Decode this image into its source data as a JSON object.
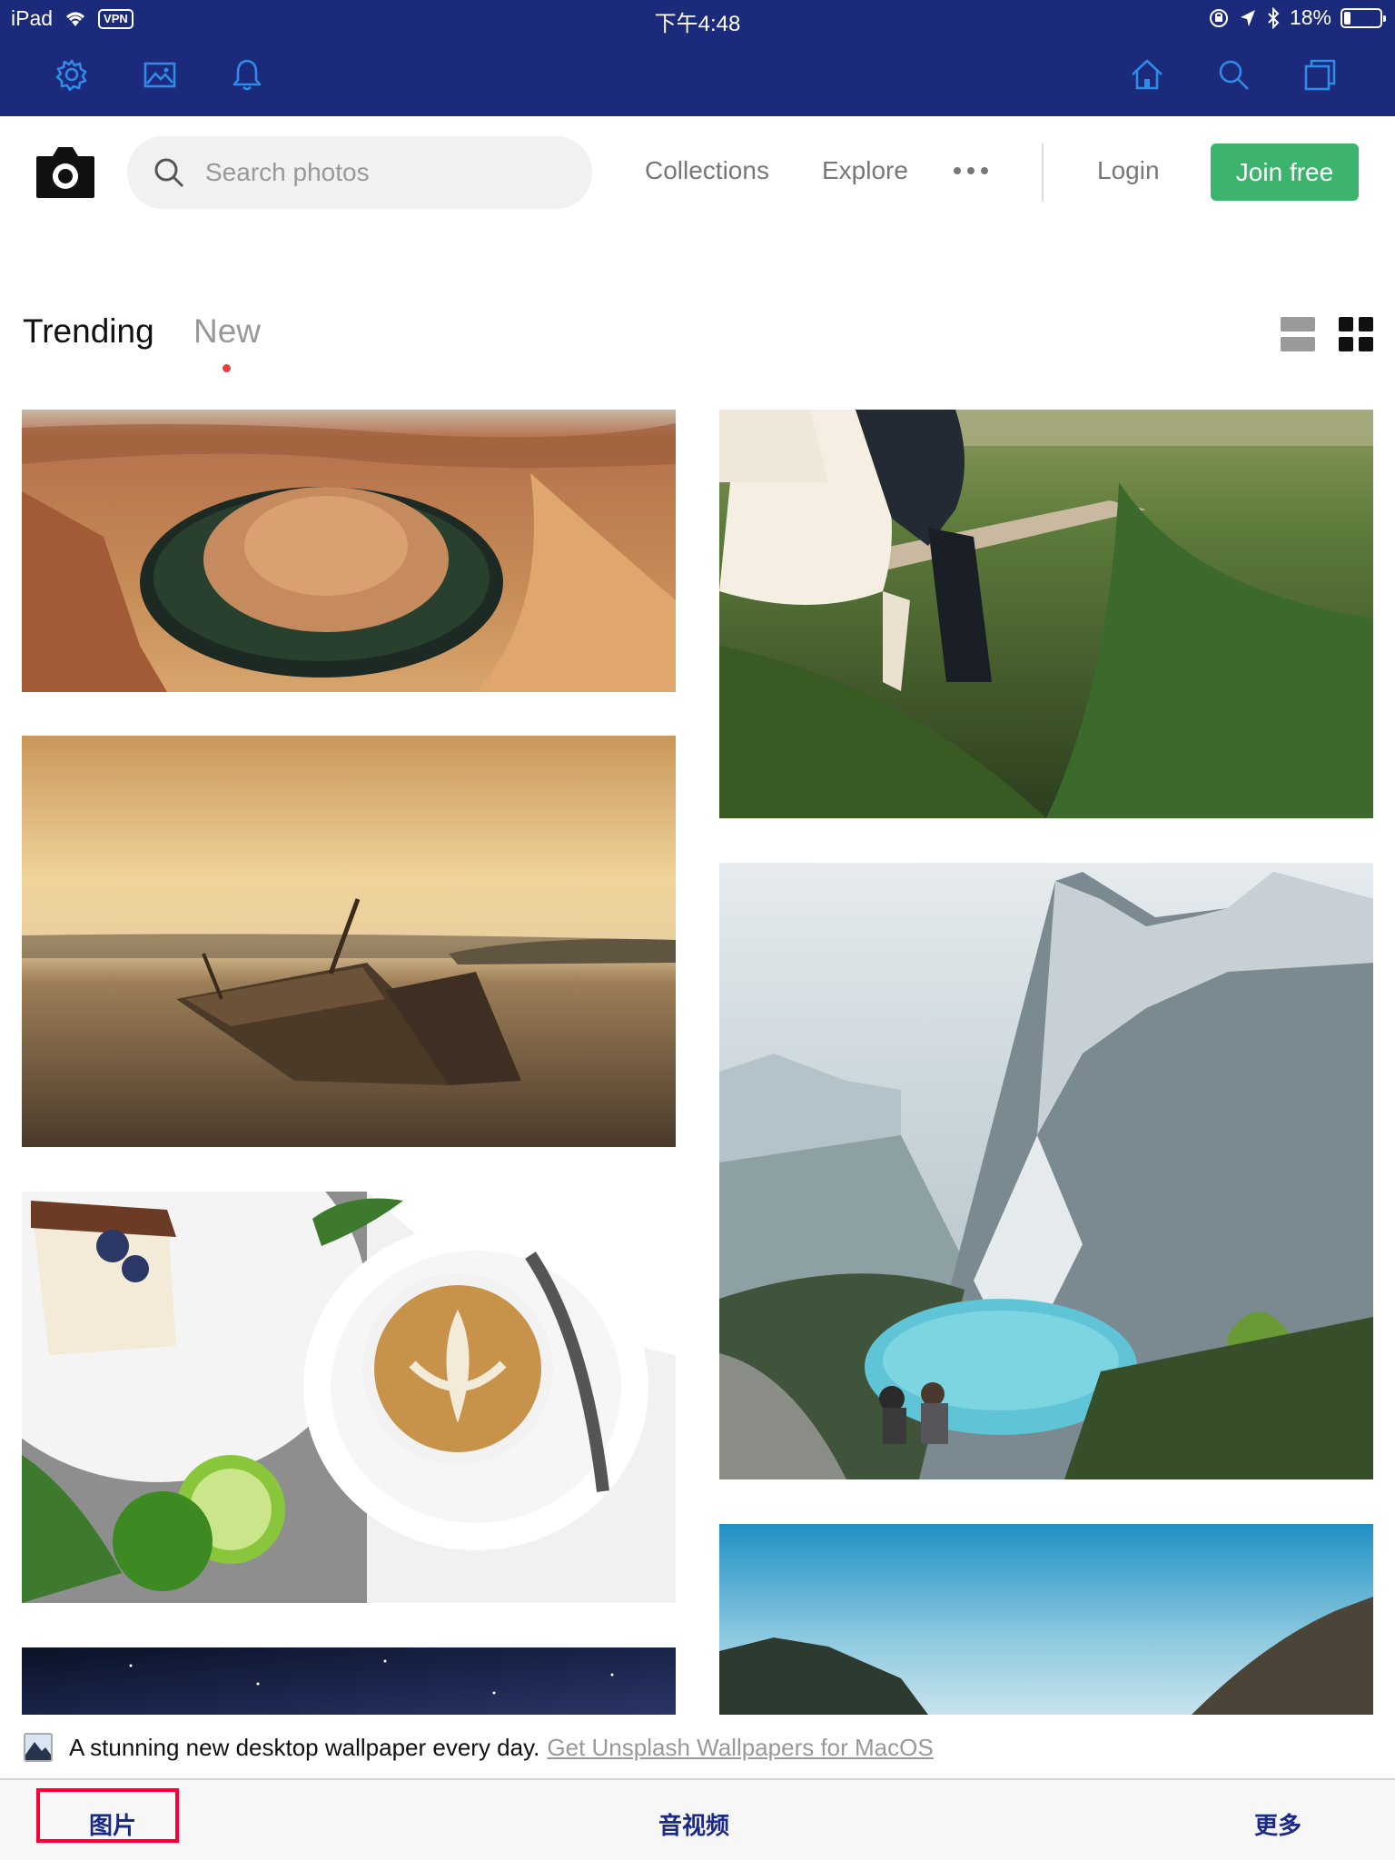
{
  "status_bar": {
    "device": "iPad",
    "vpn": "VPN",
    "time": "下午4:48",
    "battery": "18%",
    "battery_level": 0.18
  },
  "toolbar": {
    "left_icons": [
      "gear-icon",
      "image-icon",
      "bell-icon"
    ],
    "right_icons": [
      "home-icon",
      "search-icon",
      "tabs-icon"
    ],
    "background_color": "#1c2a7c",
    "icon_color": "#2f8be6"
  },
  "header": {
    "logo_icon": "camera-icon",
    "search_placeholder": "Search photos",
    "nav": {
      "collections": "Collections",
      "explore": "Explore"
    },
    "login": "Login",
    "join": "Join free",
    "join_color": "#3cb46e"
  },
  "tabs": {
    "trending": "Trending",
    "new": "New",
    "active": "New",
    "indicator_color": "#e4433d"
  },
  "view_toggle": {
    "options": [
      "list-view-icon",
      "grid-view-icon"
    ],
    "active": "grid-view-icon"
  },
  "photos": {
    "left_column": [
      "canyon-photo",
      "shipwreck-photo",
      "coffee-photo",
      "night-sky-photo"
    ],
    "right_column": [
      "wedding-couple-photo",
      "mountain-lake-photo",
      "blue-sky-photo"
    ]
  },
  "banner": {
    "text": "A stunning new desktop wallpaper every day.",
    "link": "Get Unsplash Wallpapers for MacOS"
  },
  "bottom_tabs": {
    "photos": "图片",
    "media": "音视频",
    "more": "更多",
    "selected": "图片",
    "highlight_color": "#ff0033"
  }
}
